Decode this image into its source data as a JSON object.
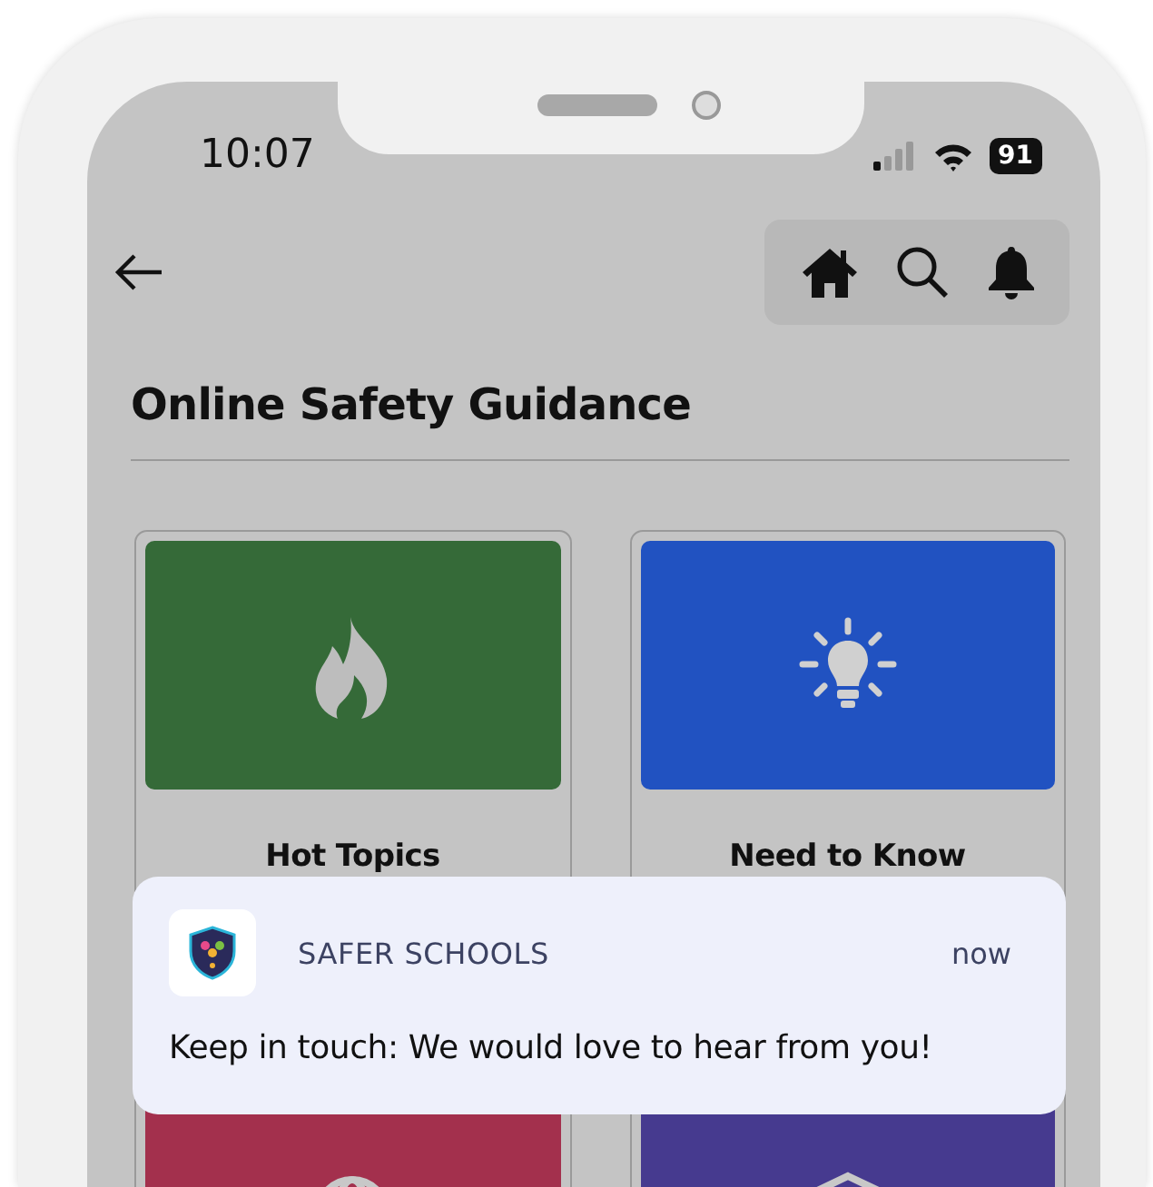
{
  "status_bar": {
    "time": "10:07",
    "battery": "91"
  },
  "header": {
    "title": "Online Safety Guidance"
  },
  "cards": [
    {
      "label": "Hot Topics",
      "color": "#356a38",
      "kind": "flame"
    },
    {
      "label": "Need to Know",
      "color": "#2152c1",
      "kind": "bulb"
    },
    {
      "color": "#a3304d",
      "kind": "globe"
    },
    {
      "color": "#463a8f",
      "kind": "box"
    }
  ],
  "notification": {
    "app": "SAFER SCHOOLS",
    "time": "now",
    "message": "Keep in touch: We would love to hear from you!"
  }
}
